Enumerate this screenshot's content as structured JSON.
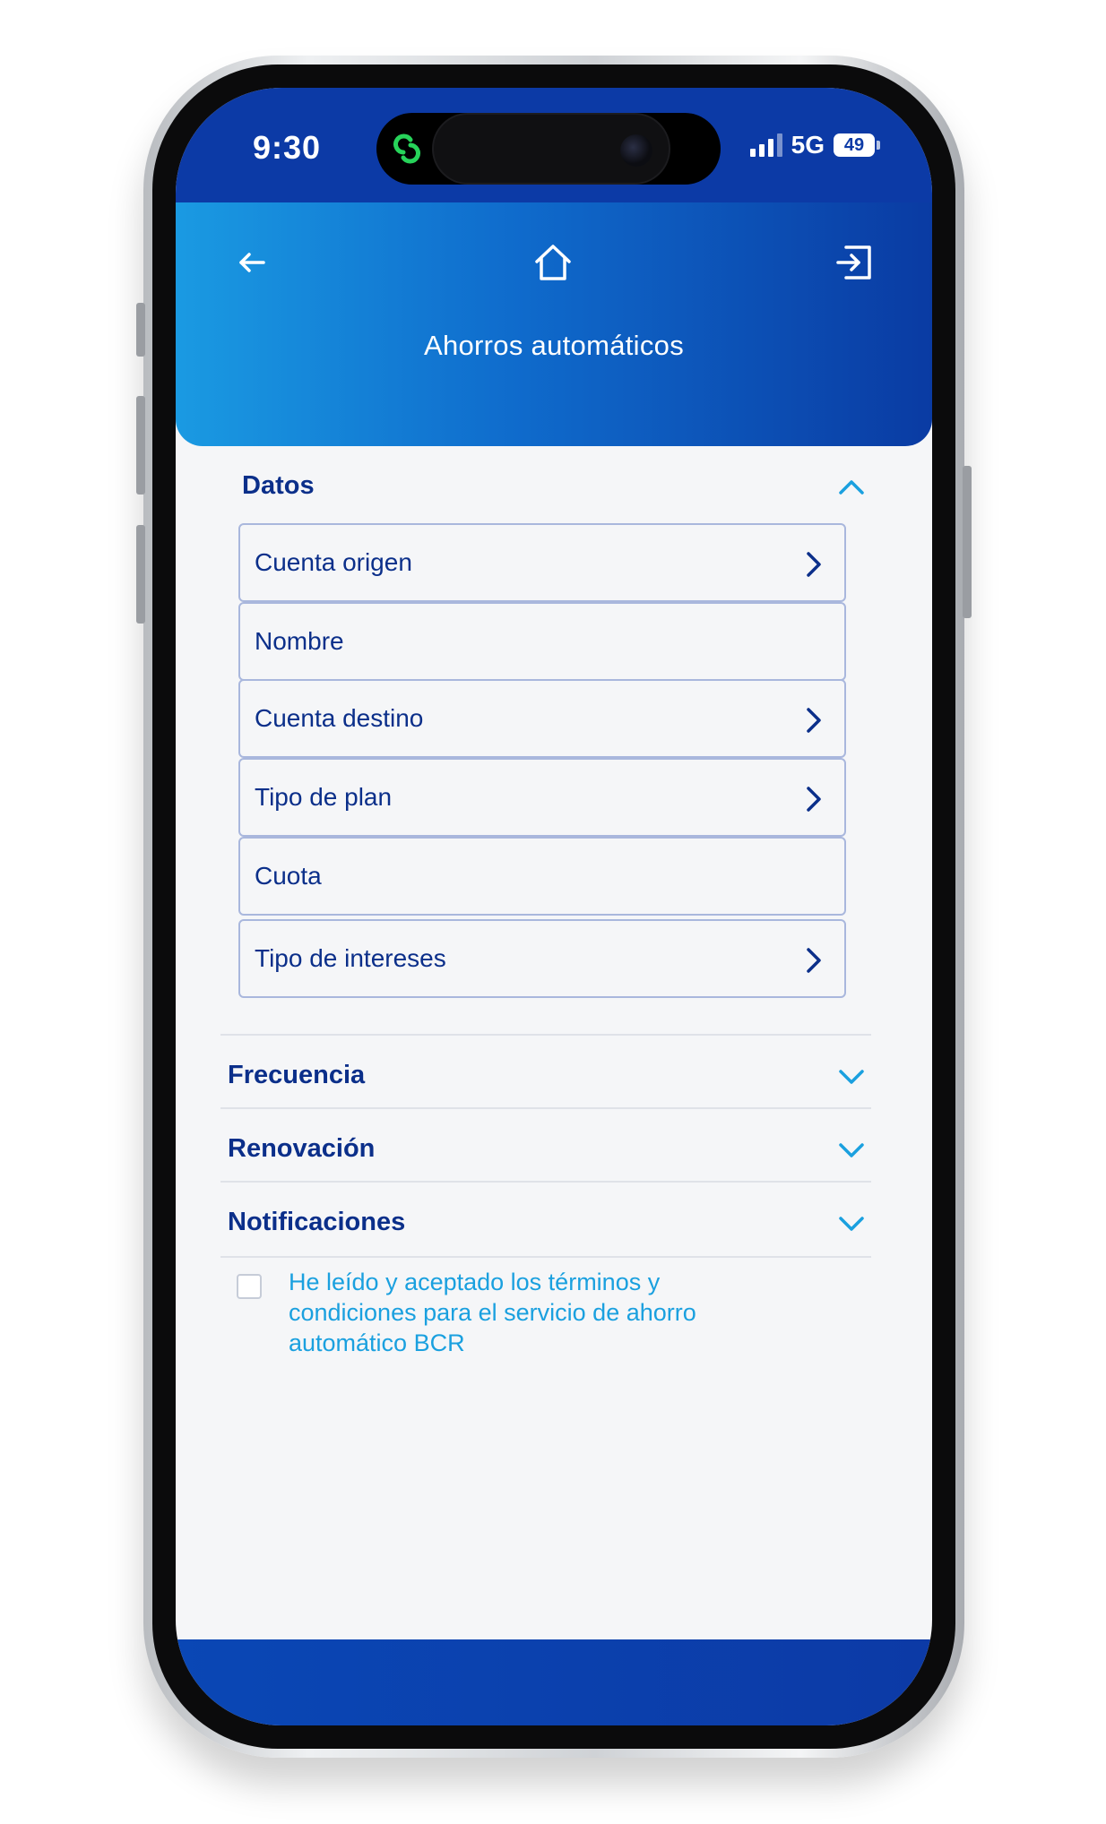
{
  "status_bar": {
    "time": "9:30",
    "network": "5G",
    "battery": "49"
  },
  "header": {
    "title": "Ahorros automáticos",
    "back_icon": "arrow-left-icon",
    "home_icon": "home-icon",
    "logout_icon": "logout-icon"
  },
  "sections": {
    "datos": {
      "title": "Datos",
      "fields": [
        {
          "label": "Cuenta origen"
        },
        {
          "label": "Nombre"
        },
        {
          "label": "Cuenta destino"
        },
        {
          "label": "Tipo de plan"
        },
        {
          "label": "Cuota"
        },
        {
          "label": "Tipo de intereses"
        }
      ]
    },
    "frecuencia": {
      "title": "Frecuencia"
    },
    "renovacion": {
      "title": "Renovación"
    },
    "notificaciones": {
      "title": "Notificaciones"
    }
  },
  "terms": {
    "text": "He leído y aceptado los términos y condiciones para el servicio de ahorro automático BCR"
  },
  "colors": {
    "primary": "#0b2f8a",
    "accent": "#1aa0df",
    "header_start": "#1a9ae2",
    "header_end": "#0a3ba3"
  }
}
